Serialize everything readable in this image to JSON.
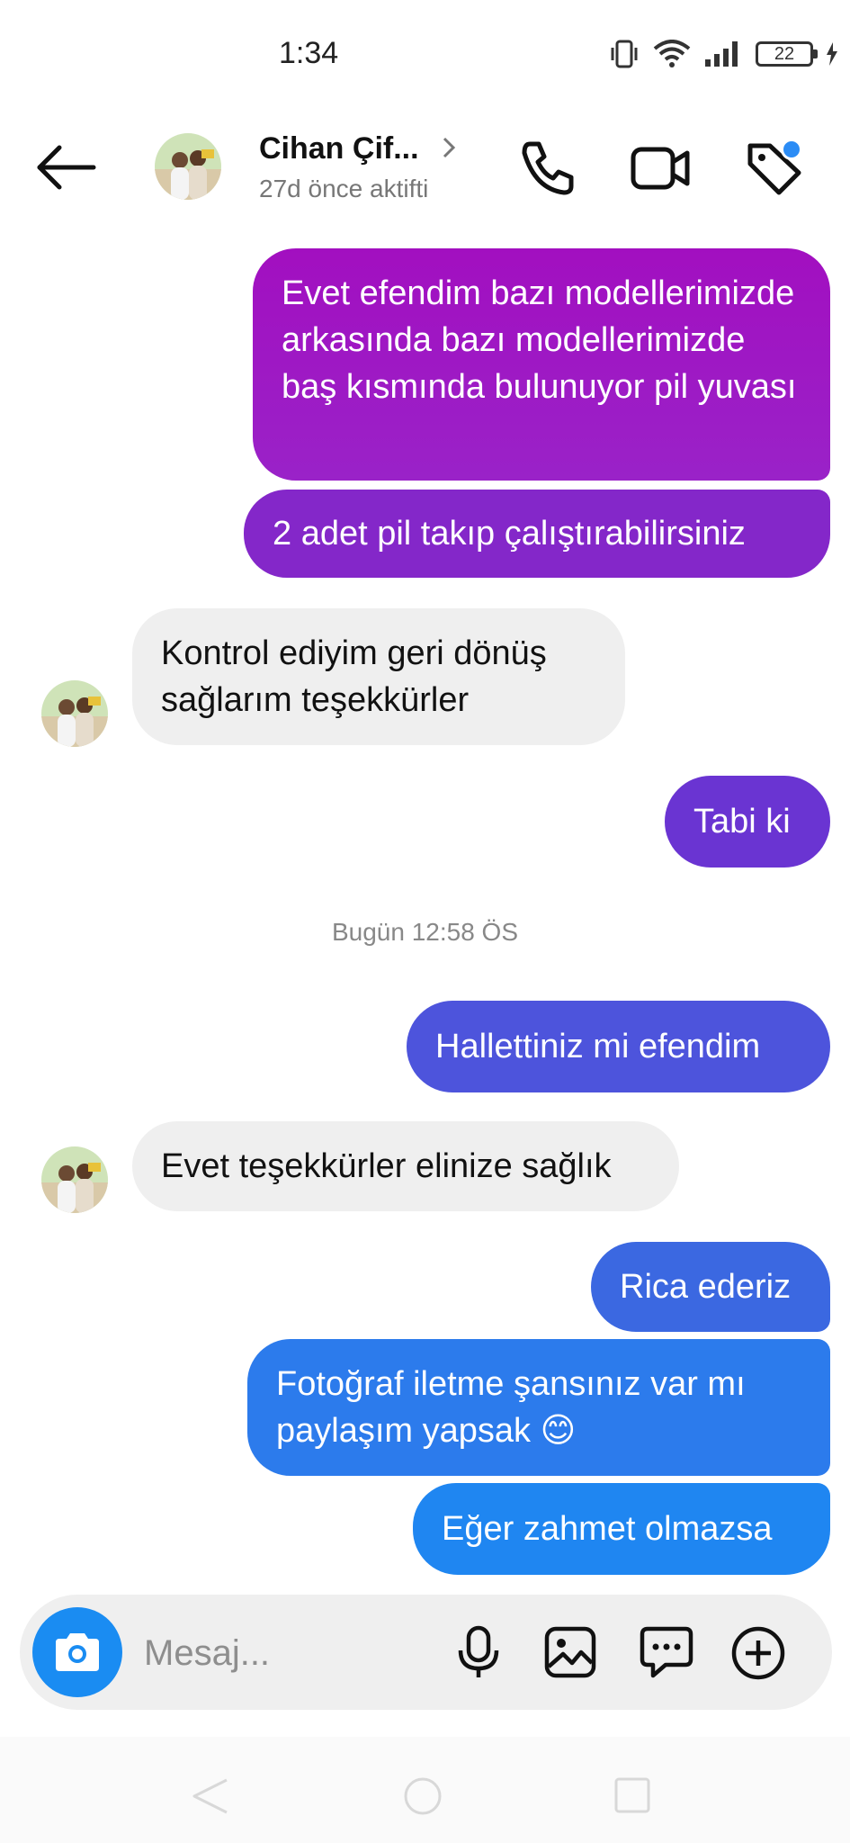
{
  "status_bar": {
    "time": "1:34",
    "battery": "22",
    "icons": [
      "vibrate-icon",
      "wifi-icon",
      "signal-icon",
      "battery-icon",
      "charging-icon"
    ]
  },
  "header": {
    "contact_name": "Cihan Çif...",
    "contact_status": "27d önce aktifti",
    "icons": [
      "back-arrow-icon",
      "chevron-right-icon",
      "phone-icon",
      "video-camera-icon",
      "tag-icon"
    ],
    "notification_dot_color": "#2b8cf5"
  },
  "messages": [
    {
      "direction": "outgoing",
      "text": "Evet efendim bazı modellerimizde arkasında bazı modellerimizde baş kısmında bulunuyor pil yuvası"
    },
    {
      "direction": "outgoing",
      "text": "2 adet pil takıp çalıştırabilirsiniz"
    },
    {
      "direction": "incoming",
      "text": "Kontrol ediyim geri dönüş sağlarım teşekkürler"
    },
    {
      "direction": "outgoing",
      "text": "Tabi ki"
    },
    {
      "direction": "outgoing",
      "text": "Hallettiniz mi efendim"
    },
    {
      "direction": "incoming",
      "text": "Evet teşekkürler elinize sağlık"
    },
    {
      "direction": "outgoing",
      "text": "Rica ederiz"
    },
    {
      "direction": "outgoing",
      "text": "Fotoğraf iletme şansınız var mı paylaşım yapsak 😊"
    },
    {
      "direction": "outgoing",
      "text": "Eğer zahmet olmazsa"
    }
  ],
  "timestamp": "Bugün 12:58 ÖS",
  "composer": {
    "placeholder": "Mesaj...",
    "icons": [
      "camera-icon",
      "microphone-icon",
      "gallery-icon",
      "sticker-icon",
      "plus-circle-icon"
    ],
    "camera_color": "#1a8cf2"
  },
  "nav_bar": {
    "icons": [
      "nav-back-icon",
      "nav-home-icon",
      "nav-recents-icon"
    ]
  },
  "colors": {
    "gradient_top": "#a20fc0",
    "gradient_bottom": "#1f86f1",
    "incoming_bubble": "#efefef"
  }
}
